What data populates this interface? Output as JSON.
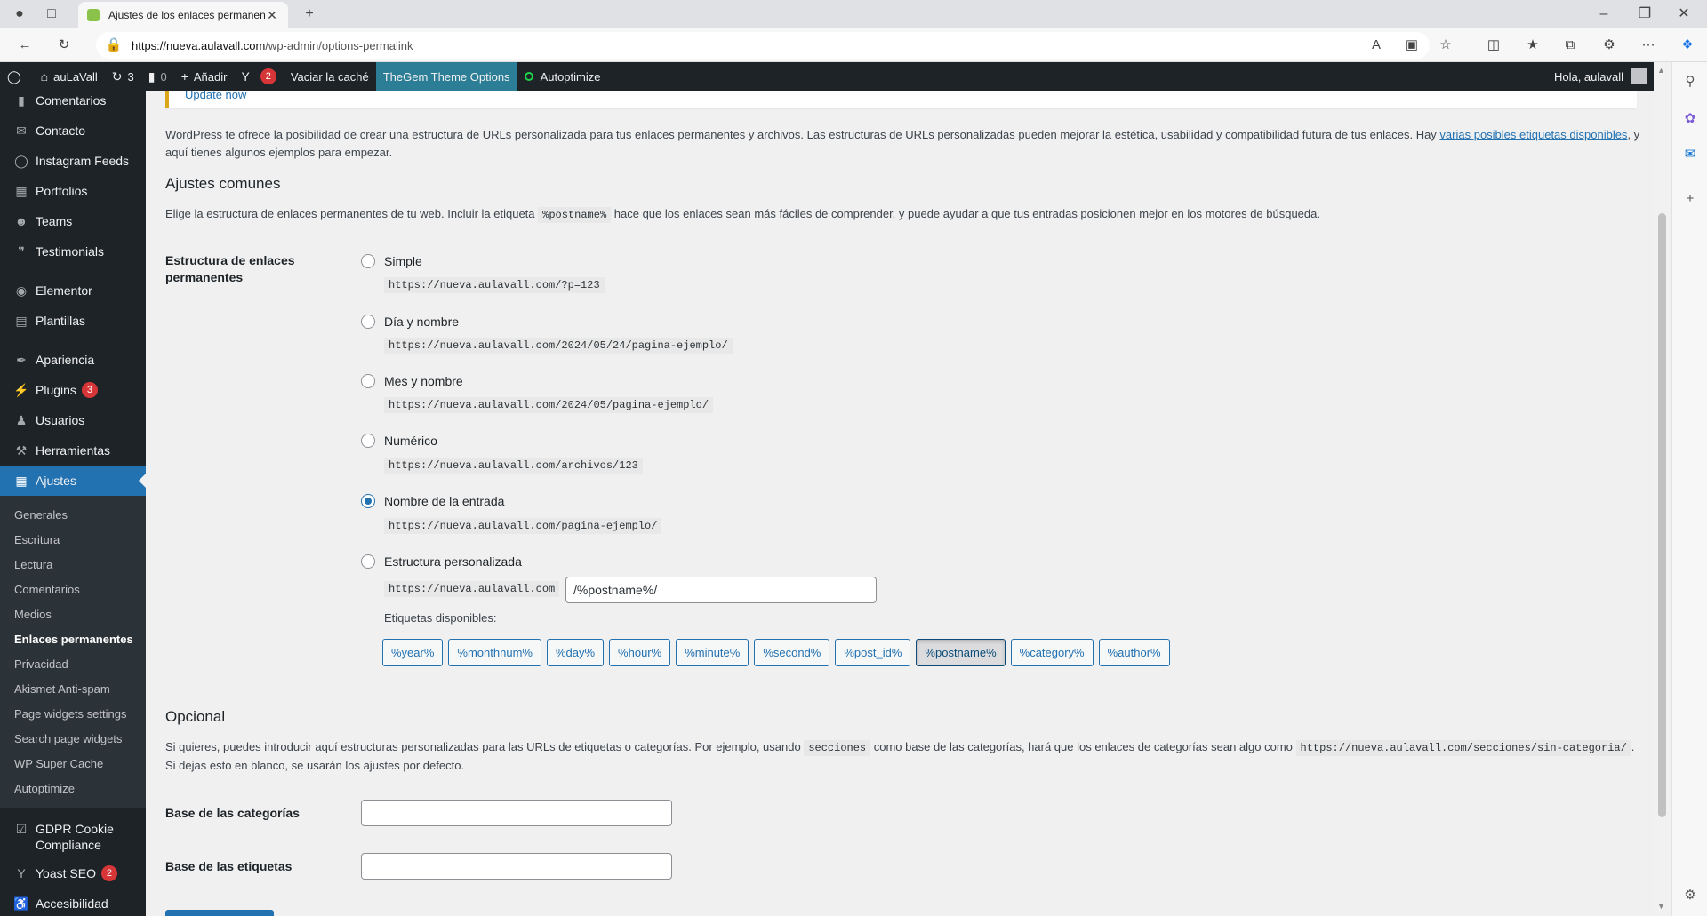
{
  "browser": {
    "tab_title": "Ajustes de los enlaces permanentes",
    "url_host": "https://nueva.aulavall.com",
    "url_path": "/wp-admin/options-permalink"
  },
  "adminbar": {
    "site_name": "auLaVall",
    "updates_count": "3",
    "comments_count": "0",
    "add_label": "Añadir",
    "yoast_count": "2",
    "clear_cache": "Vaciar la caché",
    "thegem": "TheGem Theme Options",
    "autoptimize": "Autoptimize",
    "greeting": "Hola, aulavall"
  },
  "menu": {
    "top": [
      {
        "label": "Comentarios",
        "icon": "comment-icon"
      },
      {
        "label": "Contacto",
        "icon": "mail-icon"
      },
      {
        "label": "Instagram Feeds",
        "icon": "instagram-icon"
      },
      {
        "label": "Portfolios",
        "icon": "grid-icon"
      },
      {
        "label": "Teams",
        "icon": "team-icon"
      },
      {
        "label": "Testimonials",
        "icon": "quote-icon"
      }
    ],
    "mid1": [
      {
        "label": "Elementor",
        "icon": "elementor-icon"
      },
      {
        "label": "Plantillas",
        "icon": "folder-icon"
      }
    ],
    "mid2": [
      {
        "label": "Apariencia",
        "icon": "brush-icon"
      },
      {
        "label": "Plugins",
        "icon": "plugin-icon",
        "badge": "3"
      },
      {
        "label": "Usuarios",
        "icon": "user-icon"
      },
      {
        "label": "Herramientas",
        "icon": "wrench-icon"
      }
    ],
    "active": {
      "label": "Ajustes",
      "icon": "settings-icon"
    },
    "submenu": [
      "Generales",
      "Escritura",
      "Lectura",
      "Comentarios",
      "Medios",
      "Enlaces permanentes",
      "Privacidad",
      "Akismet Anti-spam",
      "Page widgets settings",
      "Search page widgets",
      "WP Super Cache",
      "Autoptimize"
    ],
    "gdpr": "GDPR Cookie Compliance",
    "yoast": "Yoast SEO",
    "yoast_badge": "2",
    "cut_item": "Accesibilidad"
  },
  "notice": {
    "link": "Update now"
  },
  "intro": {
    "text": "WordPress te ofrece la posibilidad de crear una estructura de URLs personalizada para tus enlaces permanentes y archivos. Las estructuras de URLs personalizadas pueden mejorar la estética, usabilidad y compatibilidad futura de tus enlaces. Hay ",
    "link": "varias posibles etiquetas disponibles",
    "text2": ", y aquí tienes algunos ejemplos para empezar."
  },
  "common": {
    "heading": "Ajustes comunes",
    "desc_pre": "Elige la estructura de enlaces permanentes de tu web. Incluir la etiqueta ",
    "desc_code": "%postname%",
    "desc_post": " hace que los enlaces sean más fáciles de comprender, y puede ayudar a que tus entradas posicionen mejor en los motores de búsqueda.",
    "field_label": "Estructura de enlaces permanentes",
    "options": [
      {
        "label": "Simple",
        "code": "https://nueva.aulavall.com/?p=123",
        "checked": false
      },
      {
        "label": "Día y nombre",
        "code": "https://nueva.aulavall.com/2024/05/24/pagina-ejemplo/",
        "checked": false
      },
      {
        "label": "Mes y nombre",
        "code": "https://nueva.aulavall.com/2024/05/pagina-ejemplo/",
        "checked": false
      },
      {
        "label": "Numérico",
        "code": "https://nueva.aulavall.com/archivos/123",
        "checked": false
      },
      {
        "label": "Nombre de la entrada",
        "code": "https://nueva.aulavall.com/pagina-ejemplo/",
        "checked": true
      },
      {
        "label": "Estructura personalizada",
        "code": "https://nueva.aulavall.com",
        "checked": false
      }
    ],
    "custom_value": "/%postname%/",
    "tags_label": "Etiquetas disponibles:",
    "tags": [
      "%year%",
      "%monthnum%",
      "%day%",
      "%hour%",
      "%minute%",
      "%second%",
      "%post_id%",
      "%postname%",
      "%category%",
      "%author%"
    ]
  },
  "optional": {
    "heading": "Opcional",
    "text_pre": "Si quieres, puedes introducir aquí estructuras personalizadas para las URLs de etiquetas o categorías. Por ejemplo, usando ",
    "code1": "secciones",
    "text_mid": " como base de las categorías, hará que los enlaces de categorías sean algo como ",
    "code2": "https://nueva.aulavall.com/secciones/sin-categoria/",
    "text_post": ". Si dejas esto en blanco, se usarán los ajustes por defecto.",
    "category_label": "Base de las categorías",
    "tag_label": "Base de las etiquetas",
    "category_value": "",
    "tag_value": ""
  }
}
